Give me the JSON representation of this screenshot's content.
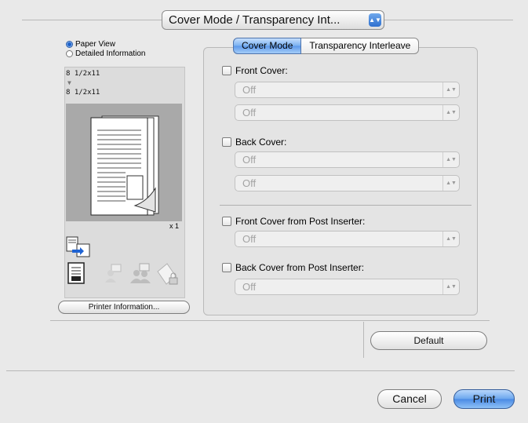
{
  "header": {
    "panel_popup": "Cover Mode / Transparency Int...",
    "popup_arrows": "▲▼"
  },
  "left": {
    "view_options": [
      {
        "label": "Paper View",
        "selected": true
      },
      {
        "label": "Detailed Information",
        "selected": false
      }
    ],
    "paper_from": "8 1/2x11",
    "paper_arrow": "▼",
    "paper_to": "8 1/2x11",
    "copies": "x 1",
    "printer_info_button": "Printer Information..."
  },
  "tabs": [
    {
      "label": "Cover Mode",
      "active": true
    },
    {
      "label": "Transparency Interleave",
      "active": false
    }
  ],
  "cover": {
    "front_cover": {
      "label": "Front Cover:",
      "checked": false,
      "select1": "Off",
      "select2": "Off"
    },
    "back_cover": {
      "label": "Back Cover:",
      "checked": false,
      "select1": "Off",
      "select2": "Off"
    },
    "front_post": {
      "label": "Front Cover from Post Inserter:",
      "checked": false,
      "select": "Off"
    },
    "back_post": {
      "label": "Back Cover from Post Inserter:",
      "checked": false,
      "select": "Off"
    }
  },
  "select_arrows": "▲▼",
  "buttons": {
    "default": "Default",
    "cancel": "Cancel",
    "print": "Print"
  },
  "colors": {
    "accent": "#4a8ae4",
    "background": "#e9e9e9"
  }
}
